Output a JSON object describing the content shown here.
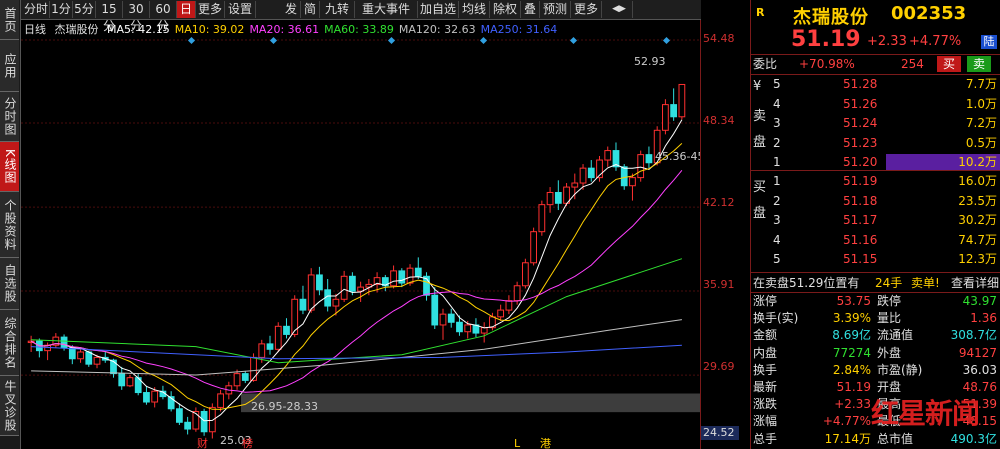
{
  "left_tabs": [
    "首页",
    "应用",
    "分时图",
    "K线图",
    "个股资料",
    "自选股",
    "综合排名",
    "牛叉诊股"
  ],
  "toolbar": {
    "periods": [
      "分时",
      "1分",
      "5分",
      "15分",
      "30分",
      "60分",
      "日",
      "更多",
      "设置"
    ],
    "tools": [
      "发",
      "简",
      "九转",
      "重大事件",
      "加自选",
      "均线",
      "除权",
      "叠",
      "预测",
      "更多"
    ],
    "icons": [
      "nav-arrows-icon"
    ]
  },
  "ma_legend": {
    "period": "日线",
    "stock": "杰瑞股份",
    "items": [
      {
        "label": "MA5: 42.15",
        "color": "#ffffff"
      },
      {
        "label": "MA10: 39.02",
        "color": "#ffd000"
      },
      {
        "label": "MA20: 36.61",
        "color": "#ff40ff"
      },
      {
        "label": "MA60: 33.89",
        "color": "#30e030"
      },
      {
        "label": "MA120: 32.63",
        "color": "#c0c0c0"
      },
      {
        "label": "MA250: 31.64",
        "color": "#4060ff"
      }
    ]
  },
  "chart_data": {
    "type": "candlestick",
    "y_ticks": [
      "54.48",
      "48.34",
      "42.12",
      "35.91",
      "29.69",
      "24.52"
    ],
    "ylim": [
      24.52,
      54.48
    ],
    "annotations": [
      "52.93",
      "45.36-45",
      "26.95-28.33",
      "25.03"
    ],
    "event_markers": [
      "财",
      "榜",
      "L",
      "港"
    ],
    "ohlc": [
      [
        32.1,
        32.6,
        31.4,
        32.2
      ],
      [
        32.2,
        32.4,
        31.0,
        31.5
      ],
      [
        31.5,
        32.1,
        30.8,
        31.9
      ],
      [
        31.9,
        32.8,
        31.7,
        32.5
      ],
      [
        32.5,
        32.7,
        31.5,
        31.7
      ],
      [
        31.7,
        31.9,
        30.5,
        30.9
      ],
      [
        30.9,
        31.6,
        30.6,
        31.4
      ],
      [
        31.4,
        31.5,
        30.3,
        30.5
      ],
      [
        30.5,
        31.2,
        30.2,
        31.0
      ],
      [
        31.0,
        31.4,
        30.6,
        30.8
      ],
      [
        30.8,
        30.9,
        29.5,
        29.8
      ],
      [
        29.8,
        30.3,
        28.6,
        28.9
      ],
      [
        28.9,
        29.7,
        28.8,
        29.5
      ],
      [
        29.5,
        29.8,
        28.2,
        28.4
      ],
      [
        28.4,
        28.9,
        27.5,
        27.7
      ],
      [
        27.7,
        28.8,
        27.3,
        28.5
      ],
      [
        28.5,
        28.9,
        27.9,
        28.1
      ],
      [
        28.1,
        28.5,
        27.0,
        27.2
      ],
      [
        27.2,
        27.6,
        26.0,
        26.2
      ],
      [
        26.2,
        26.6,
        25.3,
        25.7
      ],
      [
        25.7,
        27.3,
        25.5,
        27.0
      ],
      [
        27.0,
        27.2,
        25.2,
        25.5
      ],
      [
        25.5,
        27.6,
        25.0,
        27.3
      ],
      [
        27.3,
        28.6,
        27.0,
        28.3
      ],
      [
        28.3,
        29.2,
        27.9,
        28.9
      ],
      [
        28.9,
        30.1,
        28.6,
        29.8
      ],
      [
        29.8,
        30.0,
        29.1,
        29.3
      ],
      [
        29.3,
        31.3,
        29.2,
        31.0
      ],
      [
        31.0,
        32.3,
        30.6,
        32.0
      ],
      [
        32.0,
        32.6,
        31.2,
        31.6
      ],
      [
        31.6,
        33.6,
        31.4,
        33.3
      ],
      [
        33.3,
        33.9,
        32.4,
        32.7
      ],
      [
        32.7,
        35.6,
        32.5,
        35.3
      ],
      [
        35.3,
        36.3,
        34.2,
        34.5
      ],
      [
        34.5,
        37.6,
        34.3,
        37.1
      ],
      [
        37.1,
        37.7,
        35.6,
        36.0
      ],
      [
        36.0,
        36.8,
        34.4,
        34.8
      ],
      [
        34.8,
        35.7,
        34.1,
        35.3
      ],
      [
        35.3,
        37.4,
        35.1,
        37.0
      ],
      [
        37.0,
        37.3,
        35.6,
        35.9
      ],
      [
        35.9,
        36.6,
        35.1,
        36.2
      ],
      [
        36.2,
        36.8,
        35.6,
        36.4
      ],
      [
        36.4,
        37.3,
        35.8,
        36.9
      ],
      [
        36.9,
        37.1,
        35.9,
        36.3
      ],
      [
        36.3,
        37.8,
        36.1,
        37.4
      ],
      [
        37.4,
        37.6,
        36.2,
        36.5
      ],
      [
        36.5,
        37.9,
        36.3,
        37.6
      ],
      [
        37.6,
        38.4,
        36.8,
        37.0
      ],
      [
        37.0,
        37.3,
        35.2,
        35.6
      ],
      [
        35.6,
        36.2,
        33.1,
        33.4
      ],
      [
        33.4,
        34.6,
        32.3,
        34.2
      ],
      [
        34.2,
        34.6,
        33.2,
        33.6
      ],
      [
        33.6,
        34.1,
        32.6,
        32.9
      ],
      [
        32.9,
        33.7,
        32.4,
        33.4
      ],
      [
        33.4,
        33.9,
        32.5,
        32.8
      ],
      [
        32.8,
        33.6,
        32.1,
        33.2
      ],
      [
        33.2,
        34.3,
        33.0,
        34.0
      ],
      [
        34.0,
        34.9,
        33.7,
        34.5
      ],
      [
        34.5,
        35.6,
        34.2,
        35.2
      ],
      [
        35.2,
        36.6,
        34.9,
        36.3
      ],
      [
        36.3,
        38.3,
        36.1,
        38.0
      ],
      [
        38.0,
        40.6,
        37.8,
        40.3
      ],
      [
        40.3,
        42.6,
        40.0,
        42.3
      ],
      [
        42.3,
        43.6,
        41.7,
        43.2
      ],
      [
        43.2,
        44.1,
        41.9,
        42.4
      ],
      [
        42.4,
        43.9,
        42.2,
        43.6
      ],
      [
        43.6,
        44.6,
        42.7,
        43.9
      ],
      [
        43.9,
        45.3,
        43.4,
        45.0
      ],
      [
        45.0,
        45.6,
        44.0,
        44.3
      ],
      [
        44.3,
        45.9,
        44.0,
        45.6
      ],
      [
        45.6,
        46.6,
        45.1,
        46.3
      ],
      [
        46.3,
        46.9,
        44.8,
        45.1
      ],
      [
        45.1,
        45.3,
        43.4,
        43.7
      ],
      [
        43.7,
        44.6,
        42.6,
        44.3
      ],
      [
        44.3,
        46.3,
        44.0,
        46.0
      ],
      [
        46.0,
        46.6,
        45.0,
        45.4
      ],
      [
        45.4,
        48.1,
        45.2,
        47.8
      ],
      [
        47.8,
        50.1,
        47.5,
        49.7
      ],
      [
        49.7,
        50.9,
        48.5,
        48.8
      ],
      [
        48.8,
        51.2,
        48.6,
        51.19
      ]
    ]
  },
  "stock": {
    "badge": "R",
    "name": "杰瑞股份",
    "code": "002353",
    "price": "51.19",
    "change": "+2.33",
    "change_pct": "+4.77%",
    "exchange_badge": "陆",
    "weibi_label": "委比",
    "weibi_value": "+70.98%",
    "weicha_value": "254",
    "buy_btn": "买",
    "sell_btn": "卖"
  },
  "sell_side": {
    "label_chars": [
      "¥",
      "卖",
      "盘"
    ],
    "rows": [
      {
        "lvl": "5",
        "price": "51.28",
        "vol": "7.7万"
      },
      {
        "lvl": "4",
        "price": "51.26",
        "vol": "1.0万"
      },
      {
        "lvl": "3",
        "price": "51.24",
        "vol": "7.2万"
      },
      {
        "lvl": "2",
        "price": "51.23",
        "vol": "0.5万"
      },
      {
        "lvl": "1",
        "price": "51.20",
        "vol": "10.2万"
      }
    ]
  },
  "buy_side": {
    "label_chars": [
      "买",
      "盘"
    ],
    "rows": [
      {
        "lvl": "1",
        "price": "51.19",
        "vol": "16.0万"
      },
      {
        "lvl": "2",
        "price": "51.18",
        "vol": "23.5万"
      },
      {
        "lvl": "3",
        "price": "51.17",
        "vol": "30.2万"
      },
      {
        "lvl": "4",
        "price": "51.16",
        "vol": "74.7万"
      },
      {
        "lvl": "5",
        "price": "51.15",
        "vol": "12.3万"
      }
    ]
  },
  "order_note": {
    "text": "在卖盘51.29位置有",
    "count": "24手",
    "tag": "卖单!",
    "link": "查看详细"
  },
  "stats": [
    {
      "l1": "涨停",
      "v1": "53.75",
      "c1": "red",
      "l2": "跌停",
      "v2": "43.97",
      "c2": "green"
    },
    {
      "l1": "换手(实)",
      "v1": "3.39%",
      "c1": "yellow",
      "l2": "量比",
      "v2": "1.36",
      "c2": "red"
    },
    {
      "l1": "金额",
      "v1": "8.69亿",
      "c1": "cyan",
      "l2": "流通值",
      "v2": "308.7亿",
      "c2": "cyan"
    },
    {
      "l1": "内盘",
      "v1": "77274",
      "c1": "green",
      "l2": "外盘",
      "v2": "94127",
      "c2": "red"
    },
    {
      "l1": "换手",
      "v1": "2.84%",
      "c1": "yellow",
      "l2": "市盈(静)",
      "v2": "36.03",
      "c2": "white"
    },
    {
      "l1": "最新",
      "v1": "51.19",
      "c1": "red",
      "l2": "开盘",
      "v2": "48.76",
      "c2": "red"
    },
    {
      "l1": "涨跌",
      "v1": "+2.33",
      "c1": "red",
      "l2": "最高",
      "v2": "51.39",
      "c2": "red"
    },
    {
      "l1": "涨幅",
      "v1": "+4.77%",
      "c1": "red",
      "l2": "最低",
      "v2": "48.15",
      "c2": "red"
    },
    {
      "l1": "总手",
      "v1": "17.14万",
      "c1": "yellow",
      "l2": "总市值",
      "v2": "490.3亿",
      "c2": "cyan"
    }
  ],
  "watermark": "红星新闻"
}
